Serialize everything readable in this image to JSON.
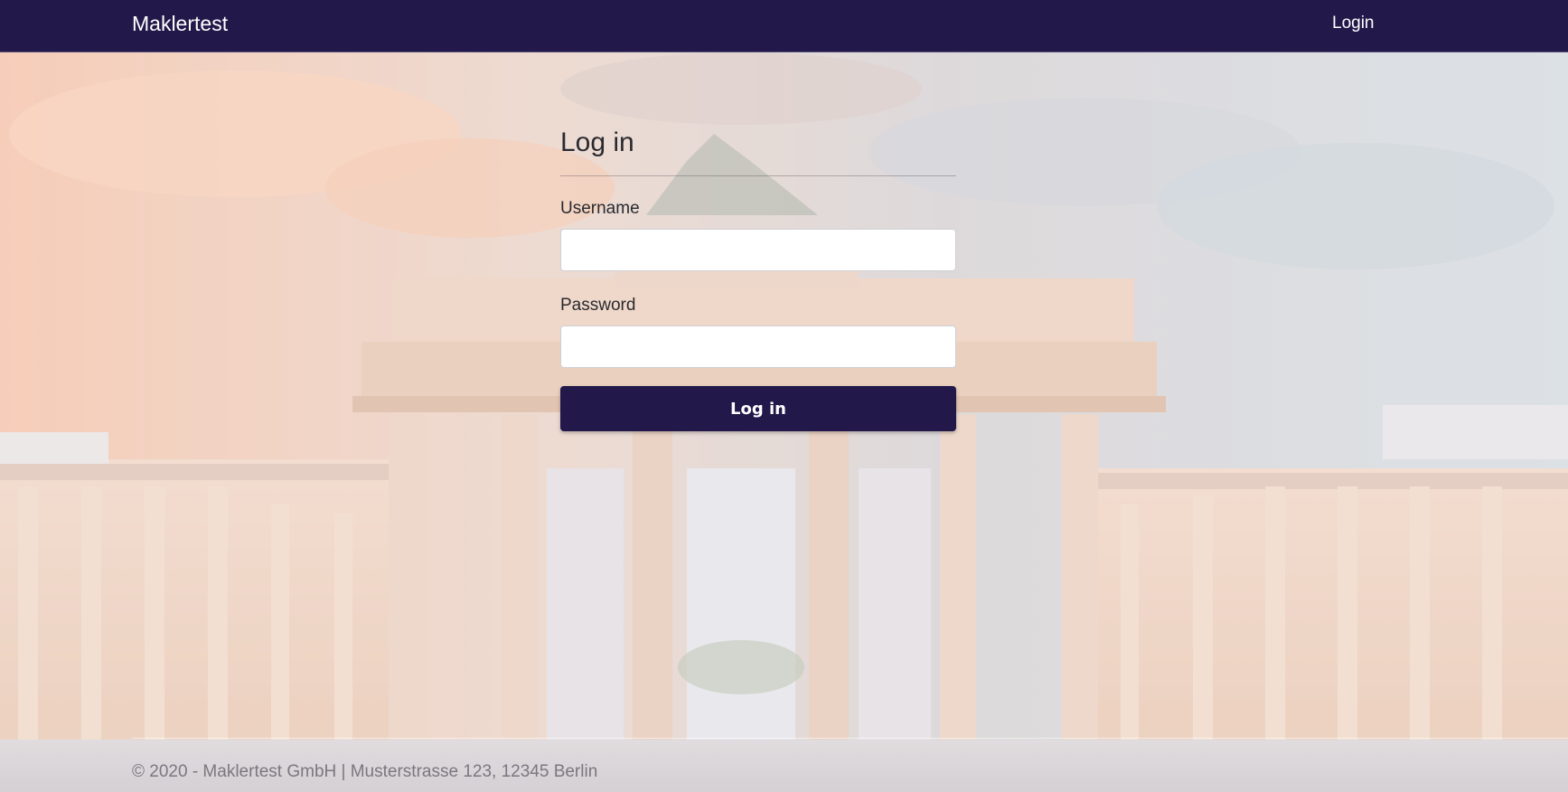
{
  "navbar": {
    "brand": "Maklertest",
    "login_link": "Login",
    "background_color": "#22184a"
  },
  "login_form": {
    "title": "Log in",
    "username_label": "Username",
    "username_value": "",
    "password_label": "Password",
    "password_value": "",
    "submit_label": "Log in",
    "button_color": "#22184a"
  },
  "background_image": {
    "icon": "brandenburg-gate-photo"
  },
  "footer": {
    "text": "© 2020 - Maklertest GmbH | Musterstrasse 123, 12345 Berlin"
  }
}
